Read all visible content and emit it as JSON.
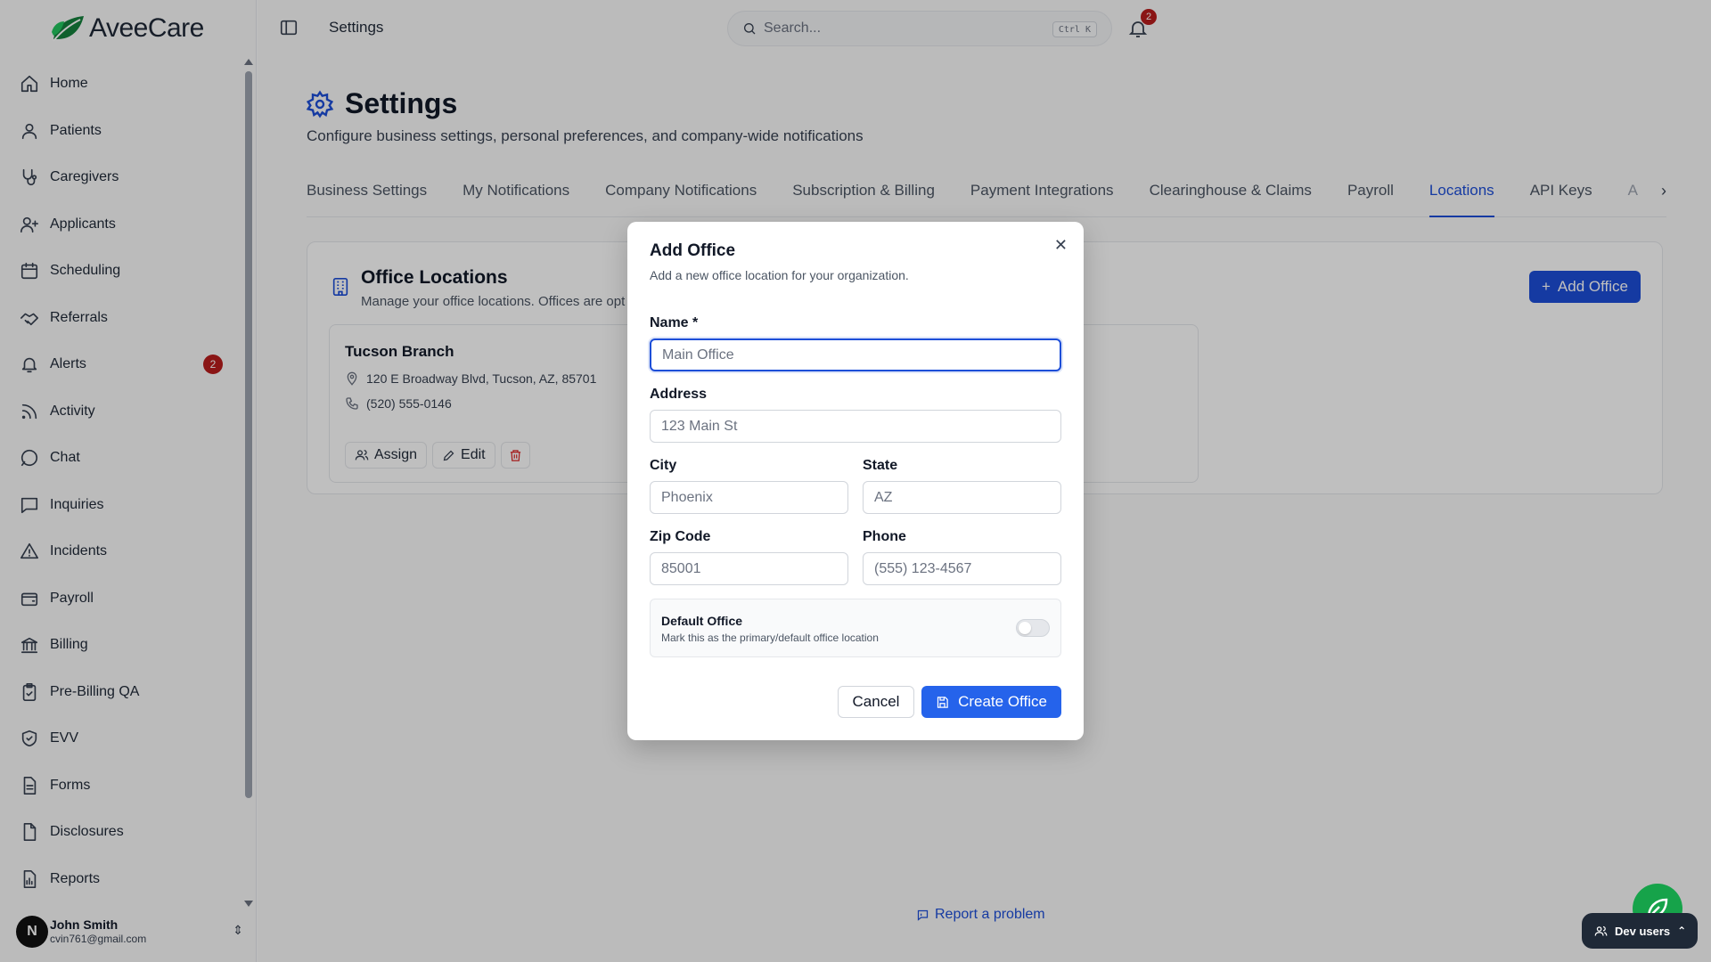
{
  "brand": {
    "name": "AveeCare",
    "accent": "#1d4ed8",
    "logo_green": "#16a34a"
  },
  "header": {
    "breadcrumb": "Settings",
    "search_placeholder": "Search...",
    "search_shortcut": "Ctrl K",
    "notifications_count": "2"
  },
  "sidebar": {
    "items": [
      {
        "label": "Home",
        "icon": "home-icon"
      },
      {
        "label": "Patients",
        "icon": "user-icon"
      },
      {
        "label": "Caregivers",
        "icon": "stethoscope-icon"
      },
      {
        "label": "Applicants",
        "icon": "user-plus-icon"
      },
      {
        "label": "Scheduling",
        "icon": "calendar-icon"
      },
      {
        "label": "Referrals",
        "icon": "handshake-icon"
      },
      {
        "label": "Alerts",
        "icon": "bell-icon",
        "badge": "2"
      },
      {
        "label": "Activity",
        "icon": "rss-icon"
      },
      {
        "label": "Chat",
        "icon": "message-circle-icon"
      },
      {
        "label": "Inquiries",
        "icon": "message-square-icon"
      },
      {
        "label": "Incidents",
        "icon": "alert-triangle-icon"
      },
      {
        "label": "Payroll",
        "icon": "wallet-icon"
      },
      {
        "label": "Billing",
        "icon": "bank-icon"
      },
      {
        "label": "Pre-Billing QA",
        "icon": "clipboard-check-icon"
      },
      {
        "label": "EVV",
        "icon": "shield-check-icon"
      },
      {
        "label": "Forms",
        "icon": "file-text-icon"
      },
      {
        "label": "Disclosures",
        "icon": "file-icon"
      },
      {
        "label": "Reports",
        "icon": "file-chart-icon"
      }
    ],
    "user": {
      "initial": "N",
      "name": "John Smith",
      "email": "cvin761@gmail.com"
    }
  },
  "page": {
    "title": "Settings",
    "subtitle": "Configure business settings, personal preferences, and company-wide notifications",
    "tabs": [
      {
        "label": "Business Settings",
        "active": false
      },
      {
        "label": "My Notifications",
        "active": false
      },
      {
        "label": "Company Notifications",
        "active": false
      },
      {
        "label": "Subscription & Billing",
        "active": false
      },
      {
        "label": "Payment Integrations",
        "active": false
      },
      {
        "label": "Clearinghouse & Claims",
        "active": false
      },
      {
        "label": "Payroll",
        "active": false
      },
      {
        "label": "Locations",
        "active": true
      },
      {
        "label": "API Keys",
        "active": false
      },
      {
        "label": "A",
        "active": false
      }
    ],
    "card": {
      "title": "Office Locations",
      "subtitle": "Manage your office locations. Offices are opt",
      "add_button": "Add Office",
      "office": {
        "name": "Tucson Branch",
        "address": "120 E Broadway Blvd, Tucson, AZ, 85701",
        "phone": "(520) 555-0146",
        "assign_label": "Assign",
        "edit_label": "Edit"
      }
    },
    "report_link": "Report a problem"
  },
  "modal": {
    "title": "Add Office",
    "description": "Add a new office location for your organization.",
    "fields": {
      "name": {
        "label": "Name *",
        "placeholder": "Main Office",
        "value": ""
      },
      "address": {
        "label": "Address",
        "placeholder": "123 Main St",
        "value": ""
      },
      "city": {
        "label": "City",
        "placeholder": "Phoenix",
        "value": ""
      },
      "state": {
        "label": "State",
        "placeholder": "AZ",
        "value": ""
      },
      "zip": {
        "label": "Zip Code",
        "placeholder": "85001",
        "value": ""
      },
      "phone": {
        "label": "Phone",
        "placeholder": "(555) 123-4567",
        "value": ""
      }
    },
    "default_office": {
      "title": "Default Office",
      "description": "Mark this as the primary/default office location",
      "enabled": false
    },
    "cancel_label": "Cancel",
    "create_label": "Create Office"
  },
  "dev_widget": {
    "label": "Dev users"
  }
}
